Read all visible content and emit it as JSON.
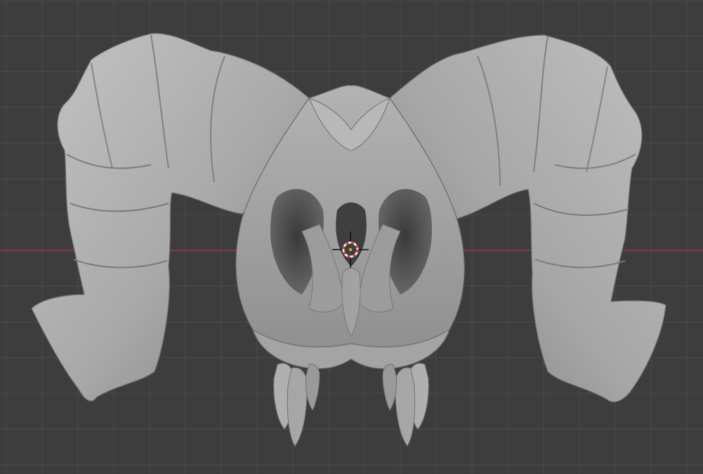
{
  "viewport": {
    "background_color": "#3d3d3d",
    "grid_color": "#4a4a4a",
    "x_axis_color": "#9a3b48",
    "model_color": "#a8a8a8",
    "cursor_colors": {
      "ring_red": "#e23c3c",
      "ring_white": "#f2f2f2",
      "crosshair": "#111111",
      "center": "#f0a020"
    }
  },
  "model": {
    "icon": "ram-skull-sculpt"
  },
  "cursor": {
    "icon": "3d-cursor-icon"
  }
}
